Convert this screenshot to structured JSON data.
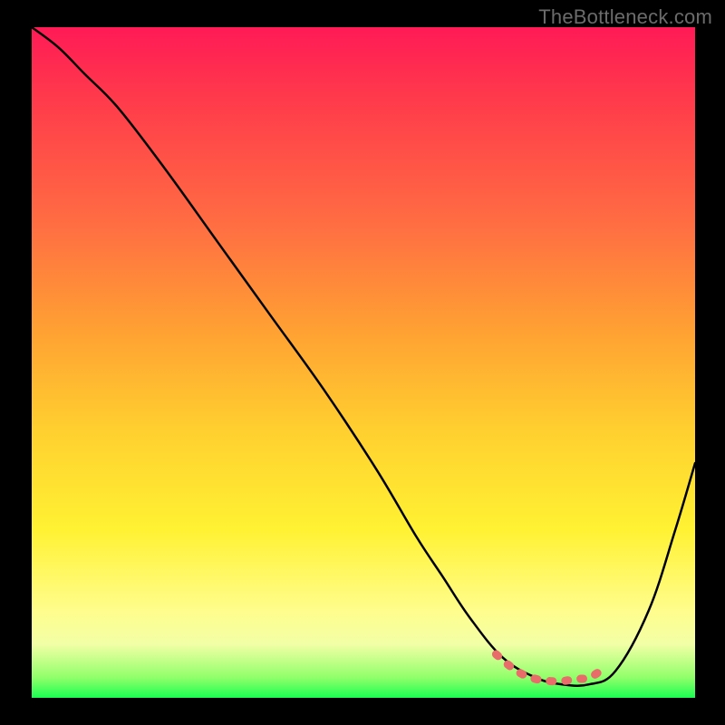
{
  "watermark": "TheBottleneck.com",
  "chart_data": {
    "type": "line",
    "title": "",
    "xlabel": "",
    "ylabel": "",
    "xlim": [
      0,
      100
    ],
    "ylim": [
      0,
      100
    ],
    "grid": false,
    "series": [
      {
        "name": "curve",
        "color": "#000000",
        "x": [
          0,
          4,
          8,
          13,
          20,
          28,
          36,
          44,
          52,
          58,
          62,
          66,
          71,
          76,
          80,
          84,
          88,
          93,
          97,
          100
        ],
        "values": [
          100,
          97,
          93,
          88,
          79,
          68,
          57,
          46,
          34,
          24,
          18,
          12,
          6,
          3,
          2,
          2,
          4,
          13,
          25,
          35
        ]
      },
      {
        "name": "highlight",
        "color": "#e86d6a",
        "x": [
          70,
          72,
          74,
          76,
          78,
          80,
          82,
          84,
          86
        ],
        "values": [
          6.5,
          4.8,
          3.5,
          2.8,
          2.5,
          2.5,
          2.8,
          3.0,
          4.2
        ]
      }
    ],
    "gradient_bands": [
      {
        "y_pct": 0,
        "color": "#ff1a56"
      },
      {
        "y_pct": 11,
        "color": "#ff3b4b"
      },
      {
        "y_pct": 30,
        "color": "#ff6f42"
      },
      {
        "y_pct": 45,
        "color": "#ffa033"
      },
      {
        "y_pct": 60,
        "color": "#ffcf2f"
      },
      {
        "y_pct": 75,
        "color": "#fff233"
      },
      {
        "y_pct": 87,
        "color": "#fffd8c"
      },
      {
        "y_pct": 92,
        "color": "#f2ffa6"
      },
      {
        "y_pct": 97,
        "color": "#90ff6a"
      },
      {
        "y_pct": 100,
        "color": "#1aff52"
      }
    ]
  }
}
